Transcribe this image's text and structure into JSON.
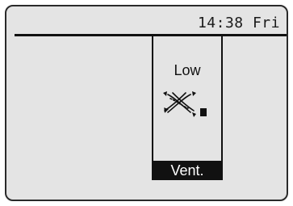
{
  "status_bar": {
    "clock": "14:38 Fri"
  },
  "ventilation": {
    "speed_label": "Low",
    "icon": "ventilation-fan-icon",
    "indicator": "fan-speed-indicator-icon",
    "mode_label": "Vent."
  },
  "colors": {
    "screen_background": "#e4e4e4",
    "foreground": "#111111",
    "tab_text": "#ffffff"
  }
}
